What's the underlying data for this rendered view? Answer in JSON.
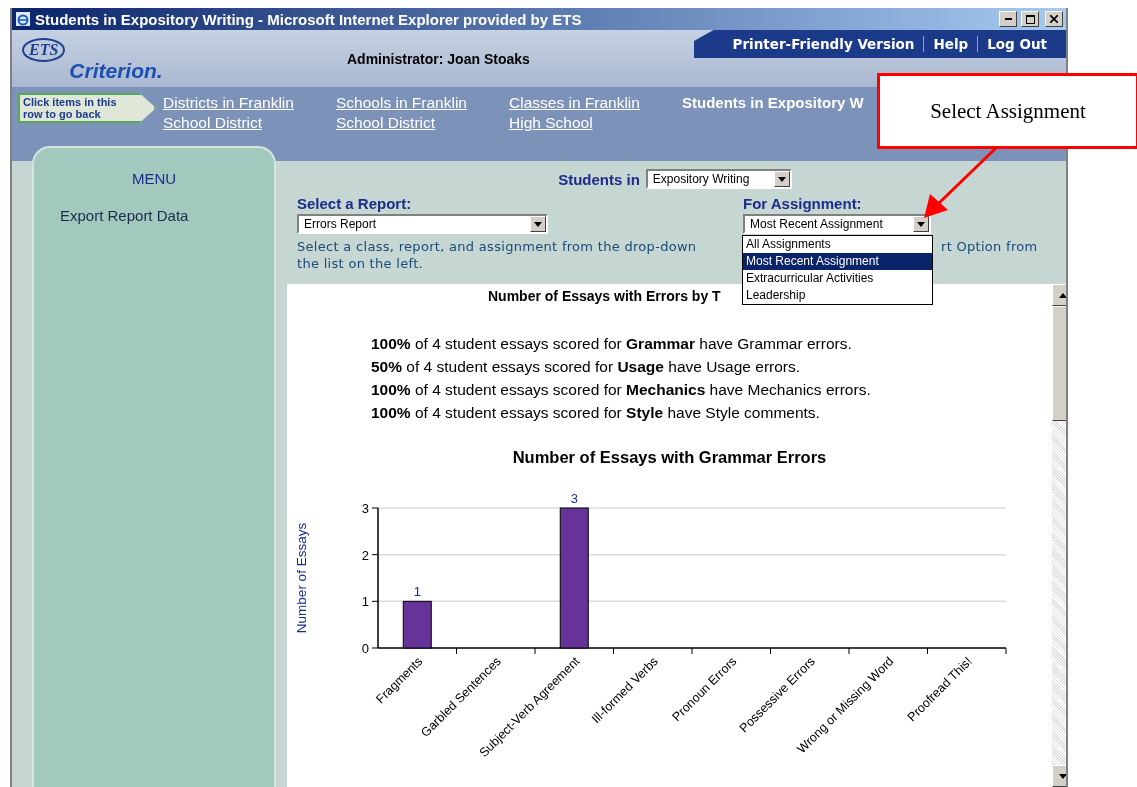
{
  "window": {
    "title": "Students in Expository Writing - Microsoft Internet Explorer provided by ETS"
  },
  "header": {
    "logo_badge": "ETS",
    "logo_text": "Criterion.",
    "user": "Administrator: Joan Stoaks",
    "links": [
      "Printer-Friendly Version",
      "Help",
      "Log Out"
    ]
  },
  "breadcrumb": {
    "hint": "Click items in this row to go back",
    "items": [
      {
        "lines": [
          "Districts in Franklin",
          "School District"
        ],
        "current": false
      },
      {
        "lines": [
          "Schools in Franklin",
          "School District"
        ],
        "current": false
      },
      {
        "lines": [
          "Classes in Franklin",
          "High School"
        ],
        "current": false
      },
      {
        "lines": [
          "Students in Expository W"
        ],
        "current": true
      }
    ]
  },
  "sidebar": {
    "title": "MENU",
    "items": [
      "Export Report Data"
    ]
  },
  "controls": {
    "class_label": "Students in",
    "class_value": "Expository Writing",
    "report_label": "Select a Report:",
    "report_value": "Errors Report",
    "assignment_label": "For Assignment:",
    "assignment_value": "Most Recent Assignment",
    "assignment_options": [
      {
        "label": "All Assignments",
        "selected": false
      },
      {
        "label": "Most Recent Assignment",
        "selected": true
      },
      {
        "label": "Extracurricular Activities",
        "selected": false
      },
      {
        "label": "Leadership",
        "selected": false
      }
    ],
    "help_text_left": "Select a class, report, and assignment from the drop-down",
    "help_text_right": "rt Option from",
    "help_text_line2": "the list on the left."
  },
  "report": {
    "title": "Number of Essays with Errors by T",
    "stats": [
      "**100%** of 4 student essays scored for **Grammar** have Grammar errors.",
      "**50%** of 4 student essays scored for **Usage** have Usage errors.",
      "**100%** of 4 student essays scored for **Mechanics** have Mechanics errors.",
      "**100%** of 4 student essays scored for **Style** have Style comments."
    ],
    "chart_data": {
      "type": "bar",
      "title": "Number of Essays with Grammar Errors",
      "ylabel": "Number of Essays",
      "categories": [
        "Fragments",
        "Garbled Sentences",
        "Subject-Verb Agreement",
        "Ill-formed Verbs",
        "Pronoun Errors",
        "Possessive Errors",
        "Wrong or Missing Word",
        "Proofread This!"
      ],
      "series": [
        {
          "color": "#663399",
          "values": [
            1,
            0,
            3,
            0,
            0,
            0,
            0,
            0
          ]
        }
      ],
      "ylim": [
        0,
        3
      ],
      "yticks": [
        0,
        1,
        2,
        3
      ],
      "value_labels": [
        "1",
        null,
        "3",
        null,
        null,
        null,
        null,
        null
      ]
    }
  },
  "callout": {
    "text": "Select Assignment"
  }
}
